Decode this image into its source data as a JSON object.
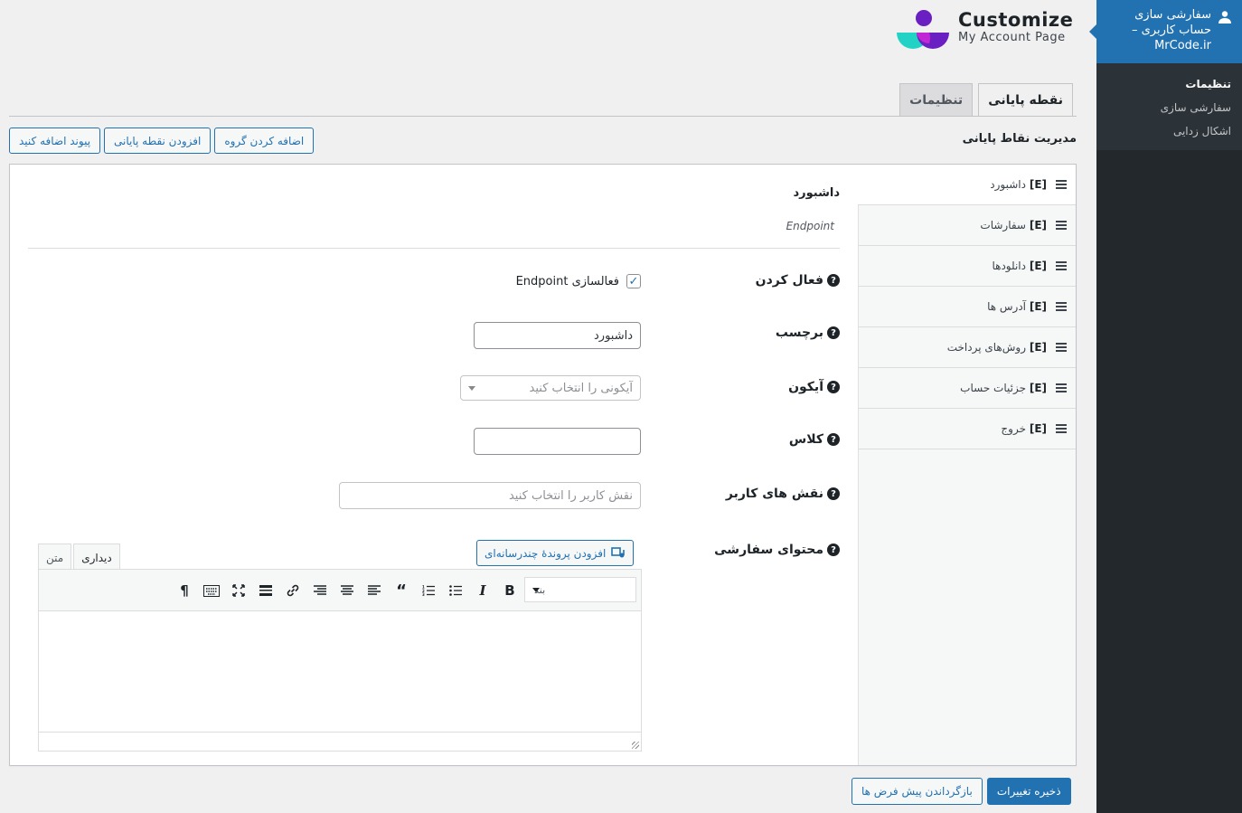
{
  "admin_menu": {
    "current_title": "سفارشی سازی حساب کاربری – MrCode.ir",
    "submenu": [
      {
        "label": "تنظیمات",
        "active": true
      },
      {
        "label": "سفارشی سازی",
        "active": false
      },
      {
        "label": "اشکال زدایی",
        "active": false
      }
    ]
  },
  "logo": {
    "title": "Customize",
    "subtitle": "My Account Page",
    "colors": {
      "purple": "#6a1fc2",
      "teal": "#22d3c5",
      "pink": "#c026d3"
    }
  },
  "tabs": [
    {
      "label": "تنظیمات",
      "active": false
    },
    {
      "label": "نقطه پایانی",
      "active": true
    }
  ],
  "section": {
    "title": "مدیریت نقاط پایانی",
    "buttons": {
      "add_group": "اضافه کردن گروه",
      "add_endpoint": "افزودن نقطه پایانی",
      "add_link": "پیوند اضافه کنید"
    }
  },
  "endpoints": [
    {
      "tag": "[E]",
      "label": "داشبورد"
    },
    {
      "tag": "[E]",
      "label": "سفارشات"
    },
    {
      "tag": "[E]",
      "label": "دانلودها"
    },
    {
      "tag": "[E]",
      "label": "آدرس ها"
    },
    {
      "tag": "[E]",
      "label": "روش‌های پرداخت"
    },
    {
      "tag": "[E]",
      "label": "جزئیات حساب"
    },
    {
      "tag": "[E]",
      "label": "خروج"
    }
  ],
  "form": {
    "heading": "داشبورد",
    "type": "Endpoint",
    "enable_label": "فعال کردن",
    "enable_checkbox_text": "فعالسازی Endpoint",
    "enable_checked": true,
    "label_label": "برچسب",
    "label_value": "داشبورد",
    "icon_label": "آیکون",
    "icon_placeholder": "آیکونی را انتخاب کنید",
    "class_label": "کلاس",
    "class_value": "",
    "roles_label": "نقش های کاربر",
    "roles_placeholder": "نقش کاربر را انتخاب کنید",
    "content_label": "محتوای سفارشی",
    "media_button": "افزودن پروندهٔ چندرسانه‌ای"
  },
  "editor": {
    "tab_visual": "دیداری",
    "tab_text": "متن",
    "format_value": "بند"
  },
  "footer": {
    "save": "ذخیره تغییرات",
    "reset": "بازگرداندن پیش فرض ها"
  }
}
